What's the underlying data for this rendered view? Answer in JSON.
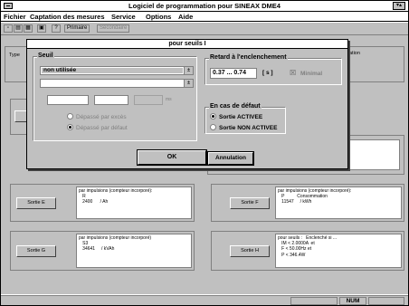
{
  "window": {
    "title": "Logiciel de programmation pour SINEAX DME4",
    "minmax_glyph": "▾▴"
  },
  "menu": [
    "Fichier",
    "Captation des mesures",
    "Service",
    "Options",
    "Aide"
  ],
  "toolbar": {
    "buttons": [
      "▫",
      "▤",
      "▦",
      "▣",
      "?"
    ],
    "primaire": "Primaire",
    "secondaire": "Secondaire"
  },
  "background": {
    "type_label": "Type",
    "right_label": "ation",
    "panels": [
      {
        "button": "Sortie E",
        "text": "par impulsions (compteur incorporé):\n   R\n   2400      / Ah"
      },
      {
        "button": "Sortie F",
        "text": "par impulsions (compteur incorporé):\n   P          Consommation\n   11547     / kWh"
      },
      {
        "button": "Sortie G",
        "text": "par impulsions (compteur incorporé)\n   S3\n   34641     / kVAh"
      },
      {
        "button": "Sortie H",
        "text": "pour seuils :   Enclenché si ...\n   IM < 2.0000A  et\n   F < 50.00Hz et\n   P < 346.4W"
      }
    ]
  },
  "dialog": {
    "title": "pour seuils I",
    "seuil": {
      "label": "Seuil",
      "combo1_value": "non utilisée",
      "combo2_value": "",
      "arrow": "±",
      "unit": "ms",
      "radio_exces": "Dépassé par excès",
      "radio_defaut": "Dépassé par défaut"
    },
    "retard": {
      "label": "Retard à l'enclenchement",
      "value": "0.37 ... 0.74",
      "unit": "[ s ]",
      "minimal_check": "☒",
      "minimal_label": "Minimal"
    },
    "defaut": {
      "label": "En cas de défaut",
      "radio_activee": "Sortie ACTIVEE",
      "radio_non_activee": "Sortie NON ACTIVEE"
    },
    "ok_label": "OK",
    "cancel_label": "Annulation"
  },
  "status": {
    "num": "NUM"
  }
}
